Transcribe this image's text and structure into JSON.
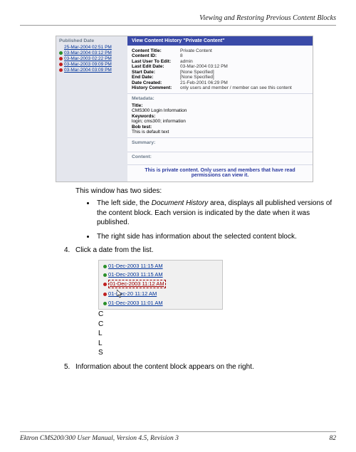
{
  "header": {
    "title": "Viewing and Restoring Previous Content Blocks"
  },
  "shot1": {
    "left_header": "Published Date",
    "history": [
      {
        "dot": "",
        "date": "25-Mar-2004 02:51 PM"
      },
      {
        "dot": "green",
        "date": "03-Mar-2004 03:12 PM"
      },
      {
        "dot": "red",
        "date": "03-Mar-2003 02:22 PM"
      },
      {
        "dot": "red",
        "date": "03-Mar-2003 09:09 PM"
      },
      {
        "dot": "red",
        "date": "03-Mar-2004 03:09 PM"
      }
    ],
    "bar": "View Content History \"Private Content\"",
    "meta": [
      {
        "k": "Content Title:",
        "v": "Private Content"
      },
      {
        "k": "Content ID:",
        "v": "8"
      },
      {
        "k": "Last User To Edit:",
        "v": "admin"
      },
      {
        "k": "Last Edit Date:",
        "v": "03-Mar-2004 03:12 PM"
      },
      {
        "k": "Start Date:",
        "v": "[None Specified]"
      },
      {
        "k": "End Date:",
        "v": "[None Specified]"
      },
      {
        "k": "Date Created:",
        "v": "21-Feb-2001 06:29 PM"
      },
      {
        "k": "History Comment:",
        "v": "only users and member / member can see this content"
      }
    ],
    "metadata_label": "Metadata:",
    "metadata": {
      "title_k": "Title:",
      "title_v": "CMS300 Login Information",
      "keywords_k": "Keywords:",
      "keywords_v": "login; cms300; information",
      "bob_k": "Bob test:",
      "bob_v": "This is default text"
    },
    "summary_label": "Summary:",
    "content_label": "Content:",
    "private_note": "This is private content. Only users and members that have read permissions can view it."
  },
  "main": {
    "intro": "This window has two sides:",
    "bullets": [
      {
        "pre": "The left side, the ",
        "em": "Document History",
        "post": " area, displays all published versions of the content block. Each version is indicated by the date when it was published."
      },
      {
        "pre": "The right side has information about the selected content block.",
        "em": "",
        "post": ""
      }
    ],
    "step4_num": "4.",
    "step4_txt": "Click a date from the list.",
    "step5_num": "5.",
    "step5_txt": "Information about the content block appears on the right."
  },
  "shot2": {
    "rows": [
      {
        "dot": "green",
        "t": "01-Dec-2003 11:15 AM",
        "sel": false
      },
      {
        "dot": "green",
        "t": "01-Dec-2003 11:15 AM",
        "sel": false
      },
      {
        "dot": "red",
        "t": "01-Dec-2003 11:12 AM",
        "sel": true
      },
      {
        "dot": "red",
        "t": "01-Dec-20     11:12 AM",
        "sel": false,
        "cursor": true
      },
      {
        "dot": "green",
        "t": "01-Dec-2003 11:01 AM",
        "sel": false
      }
    ],
    "caps": [
      "C",
      "C",
      "L",
      "L",
      "S"
    ]
  },
  "footer": {
    "left": "Ektron CMS200/300 User Manual, Version 4.5, Revision 3",
    "right": "82"
  }
}
